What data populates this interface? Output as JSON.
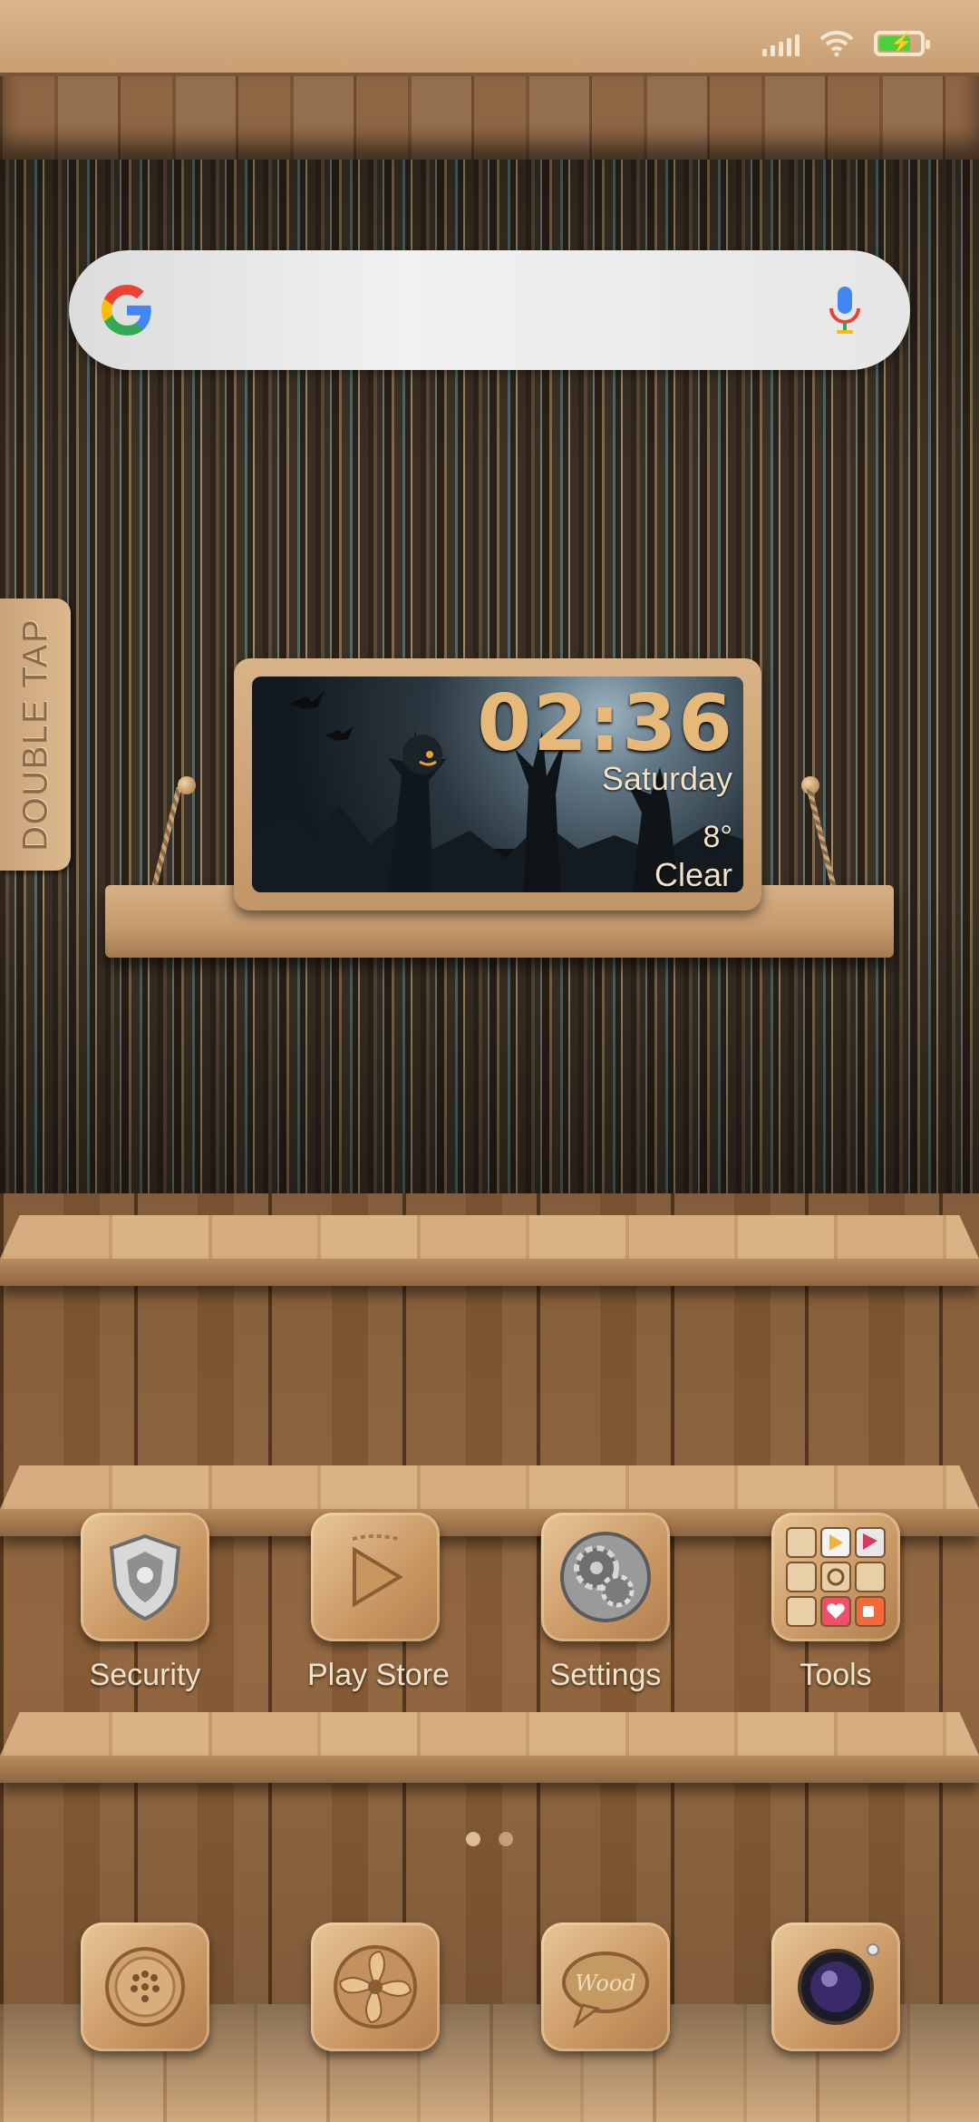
{
  "status_bar": {
    "icons": [
      "signal-icon",
      "wifi-icon",
      "battery-charging-icon"
    ],
    "battery_color": "#4bd03c"
  },
  "search": {
    "logo": "google-g-icon",
    "mic": "microphone-icon"
  },
  "side_tab": {
    "label": "DOUBLE TAP"
  },
  "clock_widget": {
    "time": "02:36",
    "day": "Saturday",
    "temperature": "8°",
    "condition": "Clear"
  },
  "apps": [
    {
      "label": "Security",
      "icon": "shield-icon"
    },
    {
      "label": "Play Store",
      "icon": "play-icon"
    },
    {
      "label": "Settings",
      "icon": "gears-icon"
    },
    {
      "label": "Tools",
      "icon": "folder-grid-icon"
    }
  ],
  "page_indicator": {
    "current": 1,
    "total": 2
  },
  "dock": [
    {
      "icon": "phone-dial-icon"
    },
    {
      "icon": "fan-icon"
    },
    {
      "icon": "message-bubble-icon",
      "text": "Wood"
    },
    {
      "icon": "camera-lens-icon"
    }
  ]
}
